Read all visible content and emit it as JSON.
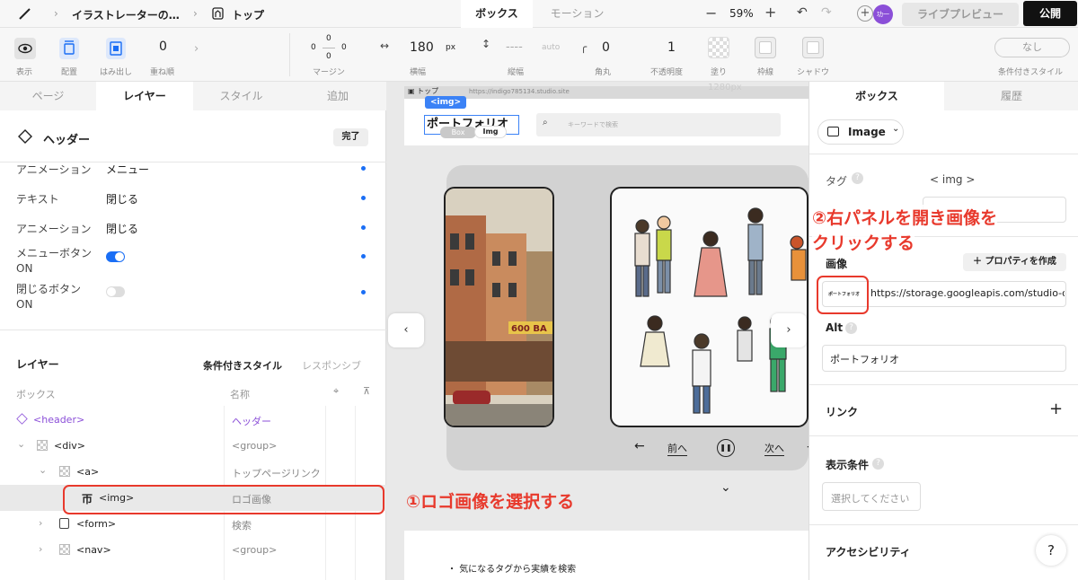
{
  "topbar": {
    "breadcrumb_project": "イラストレーターの…",
    "breadcrumb_page": "トップ",
    "mode_tabs": [
      "ボックス",
      "モーション"
    ],
    "zoom": "59%",
    "avatar": "功一",
    "preview_label": "ライブプレビュー",
    "publish_label": "公開"
  },
  "toolbar": {
    "labels": [
      "表示",
      "配置",
      "はみ出し",
      "重ね順",
      "マージン",
      "横幅",
      "縦幅",
      "角丸",
      "不透明度",
      "塗り",
      "枠線",
      "シャドウ",
      "条件付きスタイル"
    ],
    "layer_order": "0",
    "margin": {
      "top": "0",
      "left": "0",
      "right": "0",
      "bottom": "0"
    },
    "width": "180",
    "width_unit": "px",
    "height": "----",
    "height_unit": "auto",
    "radius": "0",
    "opacity": "1",
    "cond_style_value": "なし"
  },
  "left_panel": {
    "tabs": [
      "ページ",
      "レイヤー",
      "スタイル",
      "追加"
    ],
    "component_title": "ヘッダー",
    "done_label": "完了",
    "props": [
      {
        "label": "アニメーション",
        "value": "メニュー"
      },
      {
        "label": "テキスト",
        "value": "閉じる"
      },
      {
        "label": "アニメーション",
        "value": "閉じる"
      },
      {
        "label": "メニューボタン",
        "label2": "ON",
        "toggle": true
      },
      {
        "label": "閉じるボタン",
        "label2": "ON",
        "toggle": false
      }
    ],
    "layers_title": "レイヤー",
    "layers_tabs": [
      "条件付きスタイル",
      "レスポンシブ"
    ],
    "col_box": "ボックス",
    "col_name": "名称",
    "tree": [
      {
        "tag": "<header>",
        "name": "ヘッダー"
      },
      {
        "tag": "<div>",
        "name": "<group>"
      },
      {
        "tag": "<a>",
        "name": "トップページリンク"
      },
      {
        "tag": "<img>",
        "name": "ロゴ画像"
      },
      {
        "tag": "<form>",
        "name": "検索"
      },
      {
        "tag": "<nav>",
        "name": "<group>"
      }
    ]
  },
  "canvas": {
    "page_label": "トップ",
    "url": "https://indigo785134.studio.site",
    "ruler": "1280px",
    "img_tag": "<img>",
    "logo_text": "ポートフォリオ",
    "badge_box": "Box",
    "badge_img": "Img",
    "search_placeholder": "キーワードで検索",
    "prev_label": "前へ",
    "next_label": "次へ",
    "bullet_text": "気になるタグから実績を検索",
    "sign_text": "600 BA"
  },
  "right_panel": {
    "tabs": [
      "ボックス",
      "履歴"
    ],
    "element_type": "Image",
    "tag_label": "タグ",
    "tag_value": "< img >",
    "image_label": "画像",
    "add_property": "プロパティを作成",
    "image_thumb": "ポートフォリオ",
    "image_url": "https://storage.googleapis.com/studio-c",
    "alt_label": "Alt",
    "alt_value": "ポートフォリオ",
    "link_label": "リンク",
    "display_label": "表示条件",
    "display_placeholder": "選択してください",
    "a11y_label": "アクセシビリティ",
    "help": "?"
  },
  "annotations": {
    "step1": "①ロゴ画像を選択する",
    "step2_line1": "②右パネルを開き画像を",
    "step2_line2": "クリックする"
  },
  "colors": {
    "accent": "#1a6ef5",
    "annotation": "#e8392c",
    "purple": "#8b4fd8",
    "publish_bg": "#111111"
  }
}
